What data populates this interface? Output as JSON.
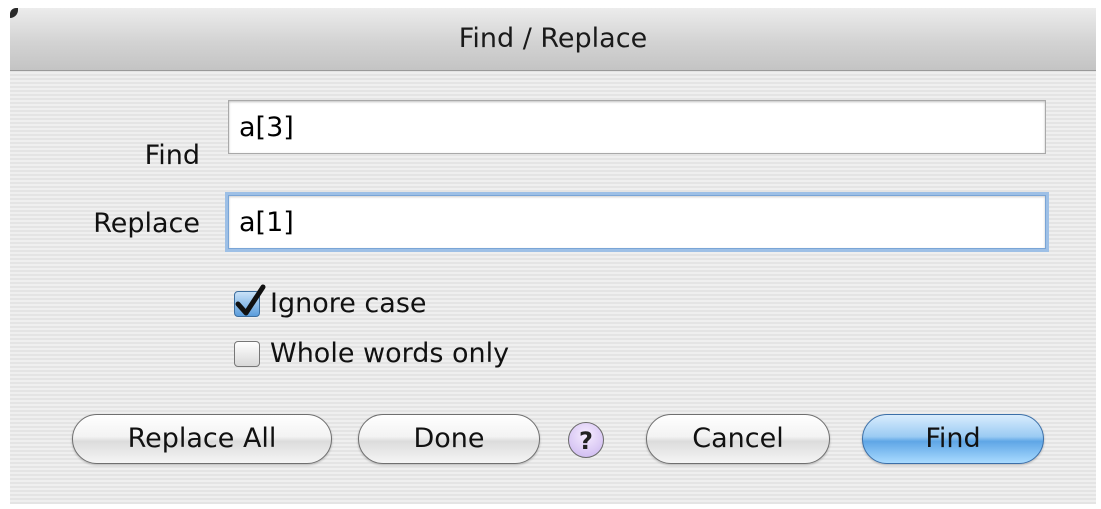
{
  "dialog": {
    "title": "Find / Replace"
  },
  "find": {
    "label": "Find",
    "value": "a[3]"
  },
  "replace": {
    "label": "Replace",
    "value": "a[1]"
  },
  "options": {
    "ignore_case": {
      "label": "Ignore case",
      "checked": true
    },
    "whole_words": {
      "label": "Whole words only",
      "checked": false
    }
  },
  "buttons": {
    "replace_all": "Replace All",
    "done": "Done",
    "help": "?",
    "cancel": "Cancel",
    "find": "Find"
  },
  "colors": {
    "default_button": "#5fa6e6",
    "focus_ring": "#9ec0e6",
    "help_button": "#c9b4ee"
  }
}
